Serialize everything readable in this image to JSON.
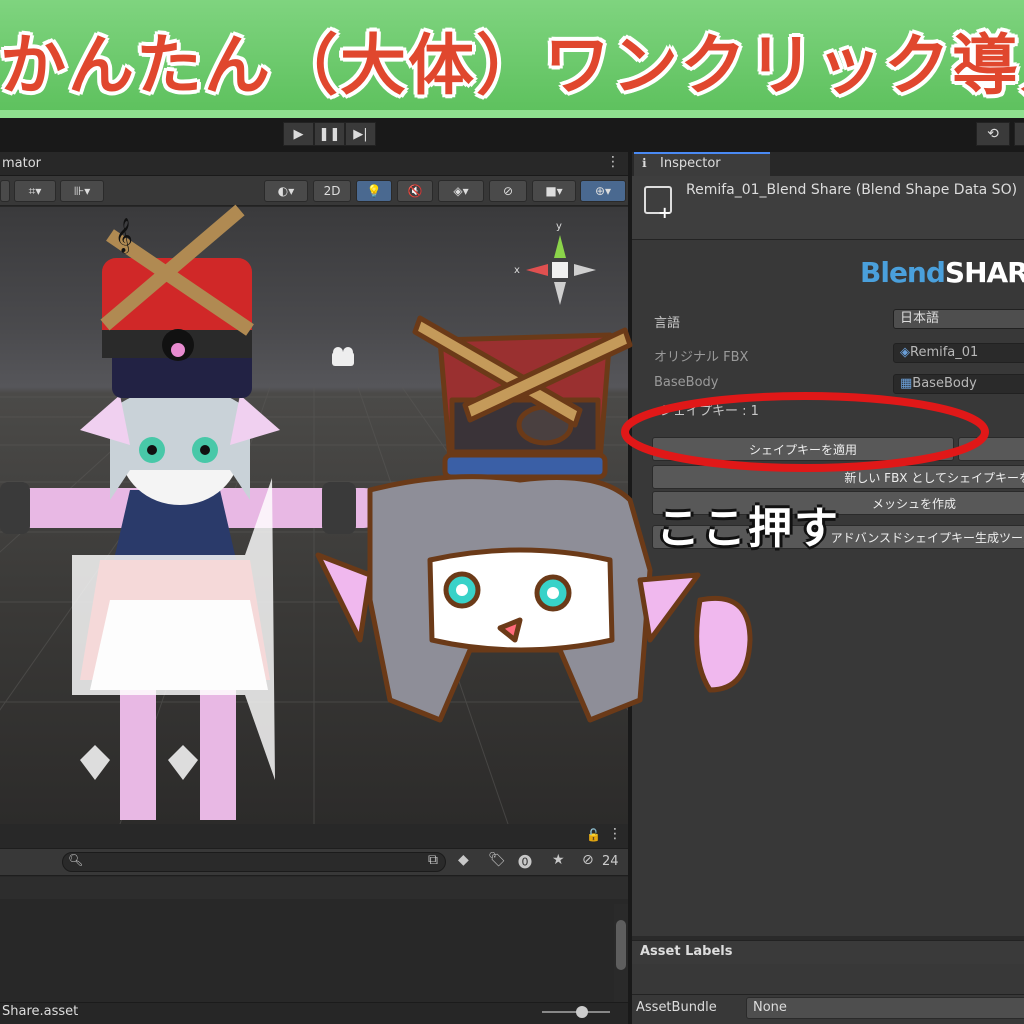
{
  "banner": {
    "title": "かんたん（大体）ワンクリック導入"
  },
  "toolbar": {
    "play_icon": "play-icon",
    "pause_icon": "pause-icon",
    "step_icon": "step-icon",
    "history_icon": "history-icon"
  },
  "scene": {
    "tab_label": "mator",
    "toolbar": {
      "mode_2d": "2D"
    }
  },
  "hierarchy": {
    "count": "24",
    "footer_file": "Share.asset"
  },
  "inspector": {
    "tab_label": "Inspector",
    "title": "Remifa_01_Blend Share (Blend Shape Data SO)",
    "logo_part1": "Blend",
    "logo_part2": "SHARE",
    "fields": {
      "language_label": "言語",
      "language_value": "日本語",
      "original_fbx_label": "オリジナル FBX",
      "original_fbx_value": "Remifa_01",
      "base_body_label": "BaseBody",
      "base_body_value": "BaseBody",
      "shape_keys_label": "シェイプキー : 1"
    },
    "buttons": {
      "apply": "シェイプキーを適用",
      "new_fbx": "新しい FBX としてシェイプキーを",
      "create_mesh": "メッシュを作成",
      "advanced": "アドバンスドシェイプキー生成ツール"
    },
    "asset_labels": "Asset Labels",
    "asset_bundle_label": "AssetBundle",
    "asset_bundle_value": "None"
  },
  "annotation": {
    "text": "ここ押す"
  },
  "colors": {
    "accent_red": "#e0472e",
    "annot_red": "#e01818",
    "blend_blue": "#4aa0dc",
    "banner_green": "#5cc05c"
  }
}
